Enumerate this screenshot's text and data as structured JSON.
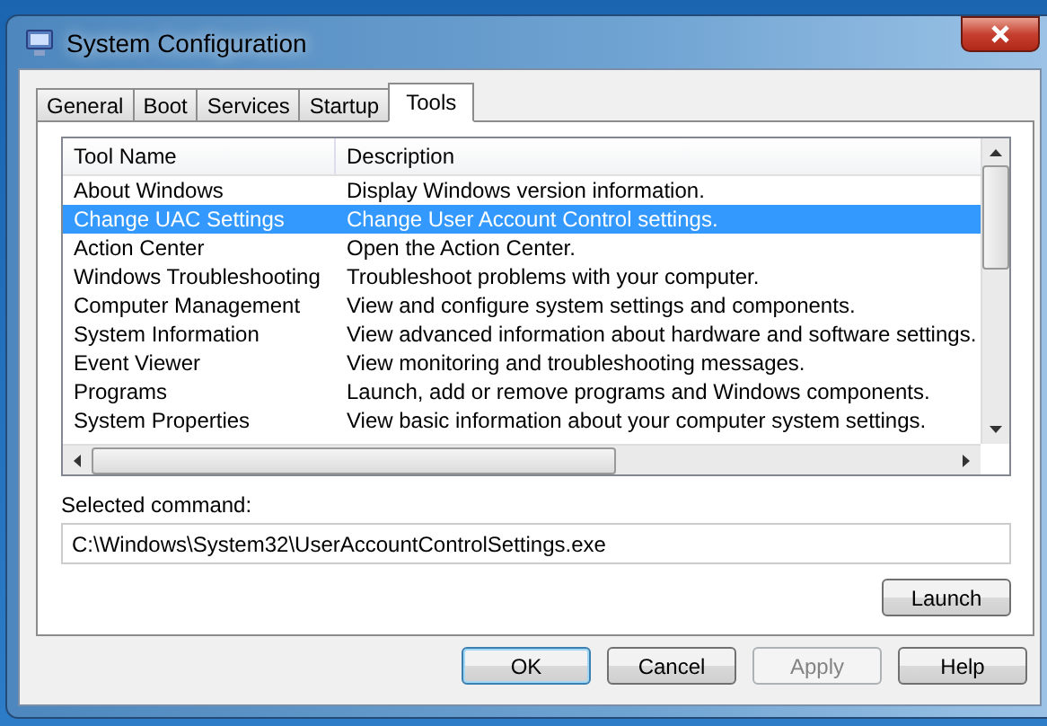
{
  "window": {
    "title": "System Configuration"
  },
  "tabs": [
    {
      "label": "General",
      "selected": false
    },
    {
      "label": "Boot",
      "selected": false
    },
    {
      "label": "Services",
      "selected": false
    },
    {
      "label": "Startup",
      "selected": false
    },
    {
      "label": "Tools",
      "selected": true
    }
  ],
  "table": {
    "columns": [
      "Tool Name",
      "Description"
    ],
    "rows": [
      {
        "cells": [
          "About Windows",
          "Display Windows version information."
        ],
        "selected": false
      },
      {
        "cells": [
          "Change UAC Settings",
          "Change User Account Control settings."
        ],
        "selected": true
      },
      {
        "cells": [
          "Action Center",
          "Open the Action Center."
        ],
        "selected": false
      },
      {
        "cells": [
          "Windows Troubleshooting",
          "Troubleshoot problems with your computer."
        ],
        "selected": false
      },
      {
        "cells": [
          "Computer Management",
          "View and configure system settings and components."
        ],
        "selected": false
      },
      {
        "cells": [
          "System Information",
          "View advanced information about hardware and software settings."
        ],
        "selected": false
      },
      {
        "cells": [
          "Event Viewer",
          "View monitoring and troubleshooting messages."
        ],
        "selected": false
      },
      {
        "cells": [
          "Programs",
          "Launch, add or remove programs and Windows components."
        ],
        "selected": false
      },
      {
        "cells": [
          "System Properties",
          "View basic information about your computer system settings."
        ],
        "selected": false
      }
    ]
  },
  "selected_command": {
    "label": "Selected command:",
    "value": "C:\\Windows\\System32\\UserAccountControlSettings.exe"
  },
  "launch_button": "Launch",
  "buttons": [
    {
      "label": "OK",
      "default": true,
      "disabled": false
    },
    {
      "label": "Cancel",
      "default": false,
      "disabled": false
    },
    {
      "label": "Apply",
      "default": false,
      "disabled": true
    },
    {
      "label": "Help",
      "default": false,
      "disabled": false
    }
  ]
}
